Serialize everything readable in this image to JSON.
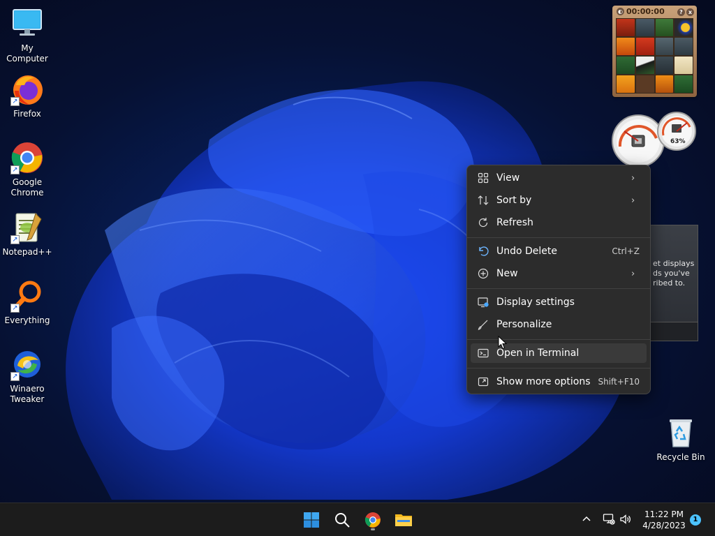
{
  "desktop_icons": [
    {
      "label": "My Computer",
      "icon": "monitor-icon"
    },
    {
      "label": "Firefox",
      "icon": "firefox-icon"
    },
    {
      "label": "Google Chrome",
      "icon": "chrome-icon"
    },
    {
      "label": "Notepad++",
      "icon": "notepadpp-icon"
    },
    {
      "label": "Everything",
      "icon": "search-magnifier-icon"
    },
    {
      "label": "Winaero Tweaker",
      "icon": "winaero-icon"
    }
  ],
  "recycle_bin": {
    "label": "Recycle Bin",
    "icon": "recycle-bin-icon"
  },
  "puzzle_gadget": {
    "timer": "00:00:00",
    "help": "?",
    "close": "x"
  },
  "gauge_gadget": {
    "memory_percent": "63%"
  },
  "feed_gadget": {
    "lines": [
      "et displays",
      "ds you've",
      "ribed to."
    ]
  },
  "context_menu": {
    "items": [
      {
        "label": "View",
        "icon": "grid-icon",
        "submenu": true
      },
      {
        "label": "Sort by",
        "icon": "sort-icon",
        "submenu": true
      },
      {
        "label": "Refresh",
        "icon": "refresh-icon"
      },
      {
        "label": "Undo Delete",
        "icon": "undo-icon",
        "shortcut": "Ctrl+Z"
      },
      {
        "label": "New",
        "icon": "plus-circle-icon",
        "submenu": true
      },
      {
        "label": "Display settings",
        "icon": "display-settings-icon"
      },
      {
        "label": "Personalize",
        "icon": "brush-icon"
      },
      {
        "label": "Open in Terminal",
        "icon": "terminal-icon",
        "hovered": true
      },
      {
        "label": "Show more options",
        "icon": "show-more-icon",
        "shortcut": "Shift+F10"
      }
    ],
    "submenu_arrow": "›"
  },
  "taskbar": {
    "apps": [
      "start-icon",
      "search-icon",
      "chrome-icon",
      "file-explorer-icon"
    ],
    "tray": {
      "overflow": "^"
    },
    "clock": {
      "time": "11:22 PM",
      "date": "4/28/2023"
    },
    "notification_count": "1"
  },
  "colors": {
    "accent": "#4cc2ff",
    "menu_bg": "#2c2c2c",
    "taskbar_bg": "#1c1c1c"
  }
}
